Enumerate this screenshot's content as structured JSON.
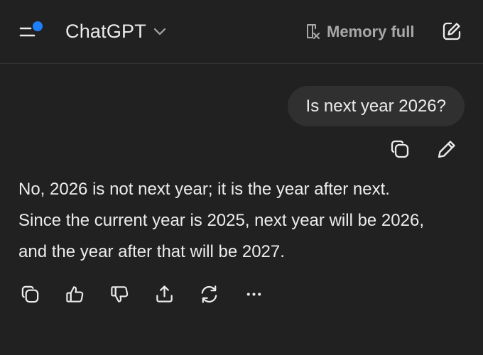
{
  "header": {
    "title": "ChatGPT",
    "memory_label": "Memory full",
    "icons": {
      "menu": "menu-with-notification-dot-icon",
      "title_dropdown": "chevron-down-icon",
      "memory": "memory-full-icon",
      "new_chat": "compose-icon"
    }
  },
  "colors": {
    "background": "#212121",
    "bubble": "#303030",
    "text": "#ececec",
    "muted": "#a8a8a8",
    "notification_dot": "#1e7ffc"
  },
  "conversation": {
    "user_message": "Is next year 2026?",
    "user_actions": [
      "copy-icon",
      "edit-icon"
    ],
    "assistant_lines": [
      "No, 2026 is not next year; it is the year after next.",
      "Since the current year is 2025, next year will be 2026,",
      "and the year after that will be 2027."
    ],
    "assistant_actions": [
      "copy-icon",
      "thumbs-up-icon",
      "thumbs-down-icon",
      "share-icon",
      "regenerate-icon",
      "more-icon"
    ]
  }
}
